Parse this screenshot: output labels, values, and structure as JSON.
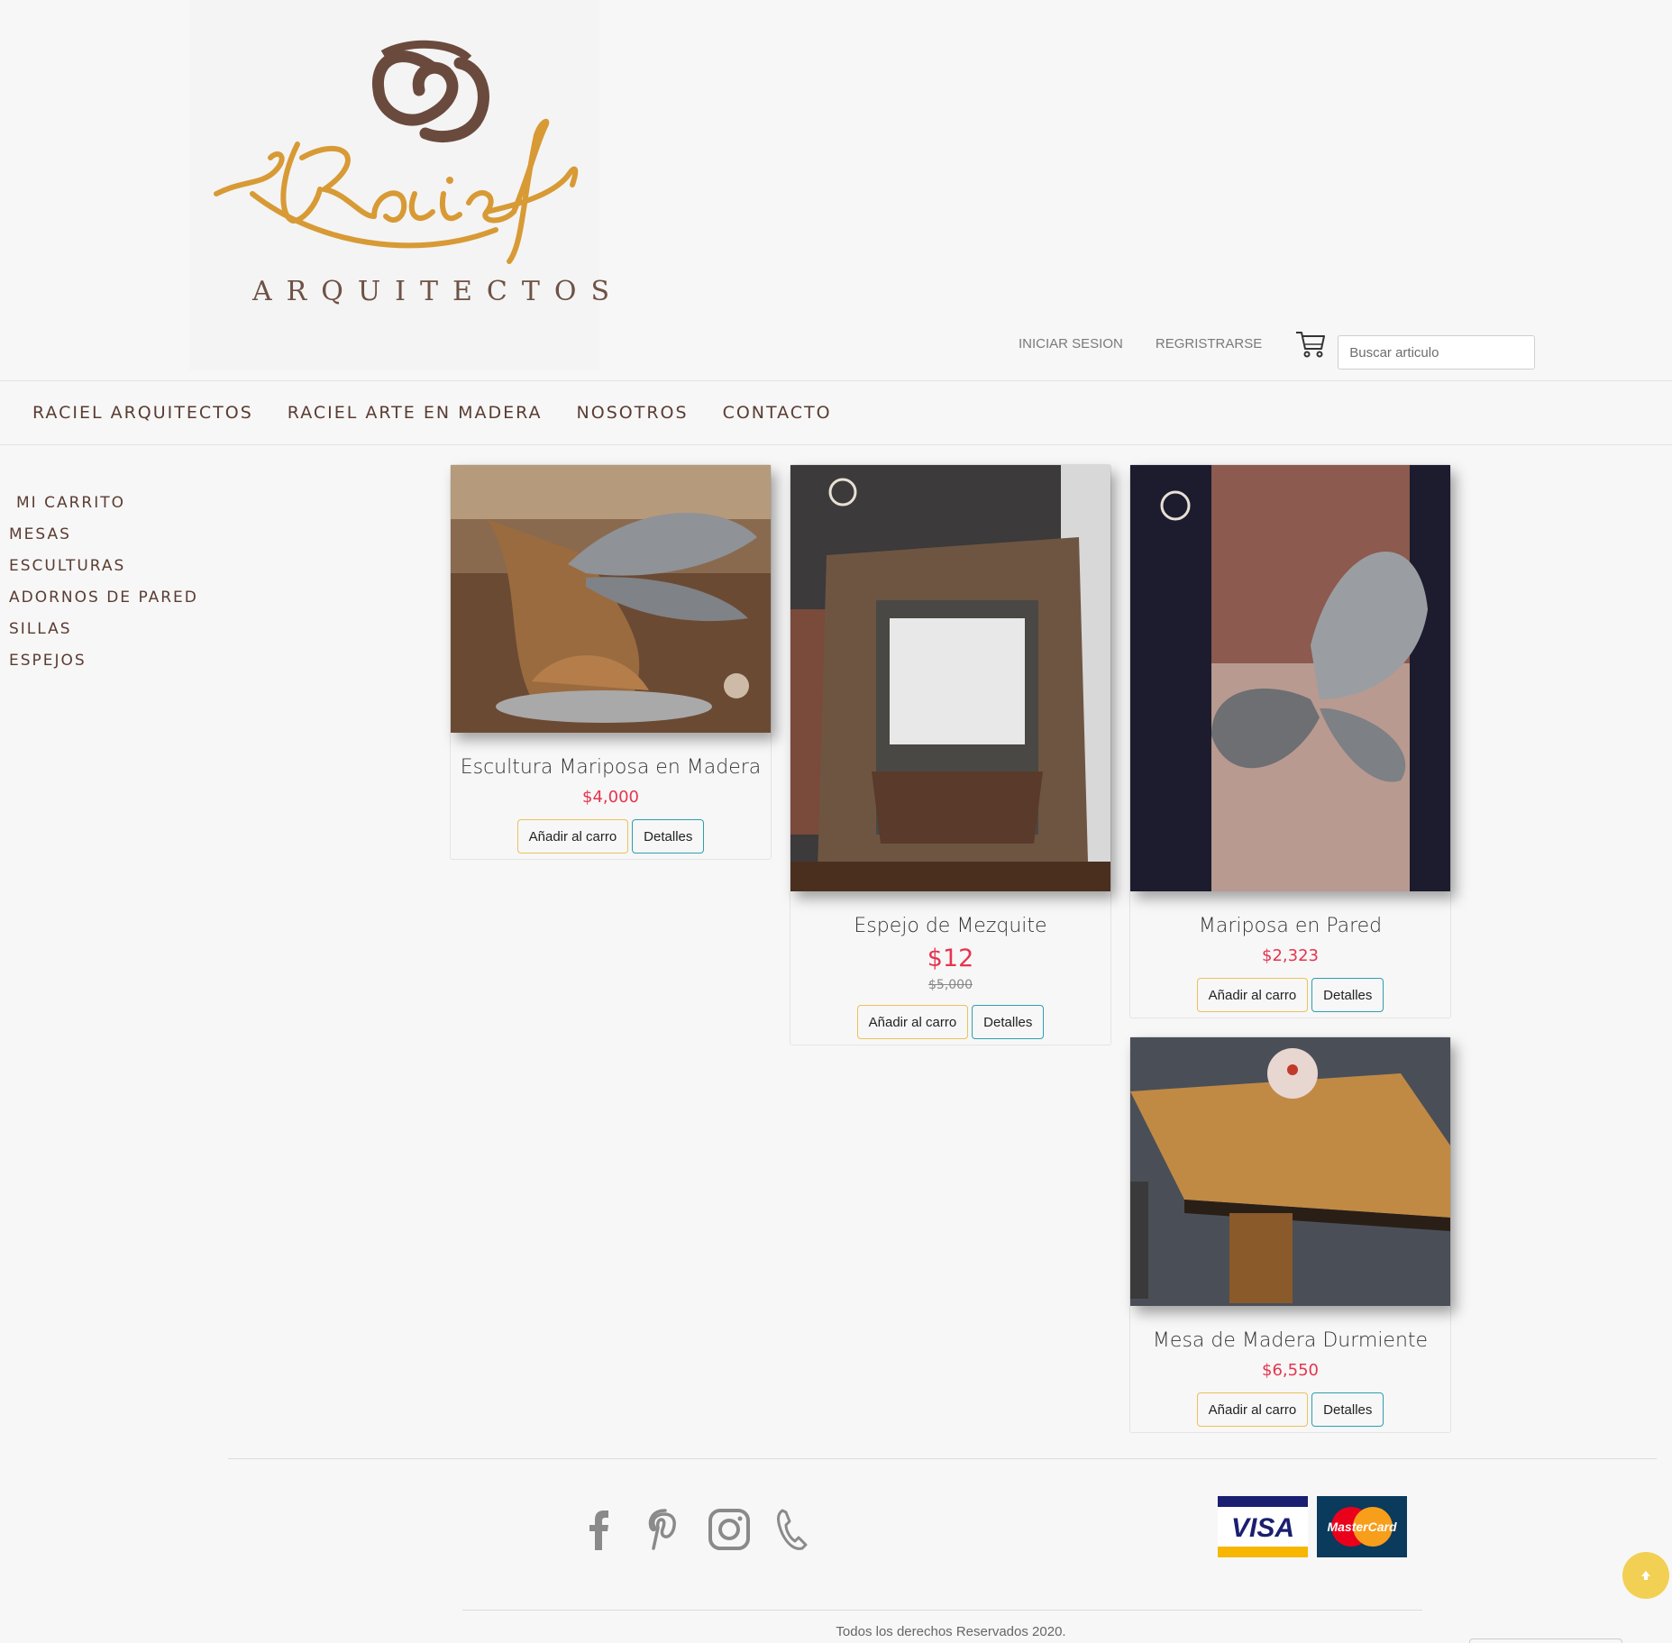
{
  "brand": {
    "logo_word": "ARQUITECTOS"
  },
  "header": {
    "login_label": "INICIAR SESION",
    "register_label": "REGRISTRARSE",
    "search_placeholder": "Buscar articulo"
  },
  "nav": {
    "items": [
      "RACIEL ARQUITECTOS",
      "RACIEL ARTE EN MADERA",
      "NOSOTROS",
      "CONTACTO"
    ]
  },
  "sidebar": {
    "items": [
      "MI CARRITO",
      "MESAS",
      "ESCULTURAS",
      "ADORNOS DE PARED",
      "SILLAS",
      "ESPEJOS"
    ]
  },
  "products": [
    {
      "title": "Escultura Mariposa en Madera",
      "price": "$4,000",
      "old_price": "",
      "add_label": "Añadir al carro",
      "details_label": "Detalles"
    },
    {
      "title": "Espejo de Mezquite",
      "price": "$12",
      "old_price": "$5,000",
      "add_label": "Añadir al carro",
      "details_label": "Detalles"
    },
    {
      "title": "Mariposa en Pared",
      "price": "$2,323",
      "old_price": "",
      "add_label": "Añadir al carro",
      "details_label": "Detalles"
    },
    {
      "title": "Mesa de Madera Durmiente",
      "price": "$6,550",
      "old_price": "",
      "add_label": "Añadir al carro",
      "details_label": "Detalles"
    }
  ],
  "footer": {
    "social_icons": [
      "facebook-icon",
      "pinterest-icon",
      "instagram-icon",
      "phone-icon"
    ],
    "payment_labels": [
      "VISA",
      "MasterCard"
    ],
    "copyright": "Todos los derechos Reservados 2020."
  },
  "colors": {
    "accent_brown": "#5a3c32",
    "logo_gold": "#d89a35",
    "price_red": "#e5354f",
    "cart_button_border": "#e9c25a",
    "details_button_border": "#2e9fad",
    "scroll_button": "#f2d054"
  }
}
